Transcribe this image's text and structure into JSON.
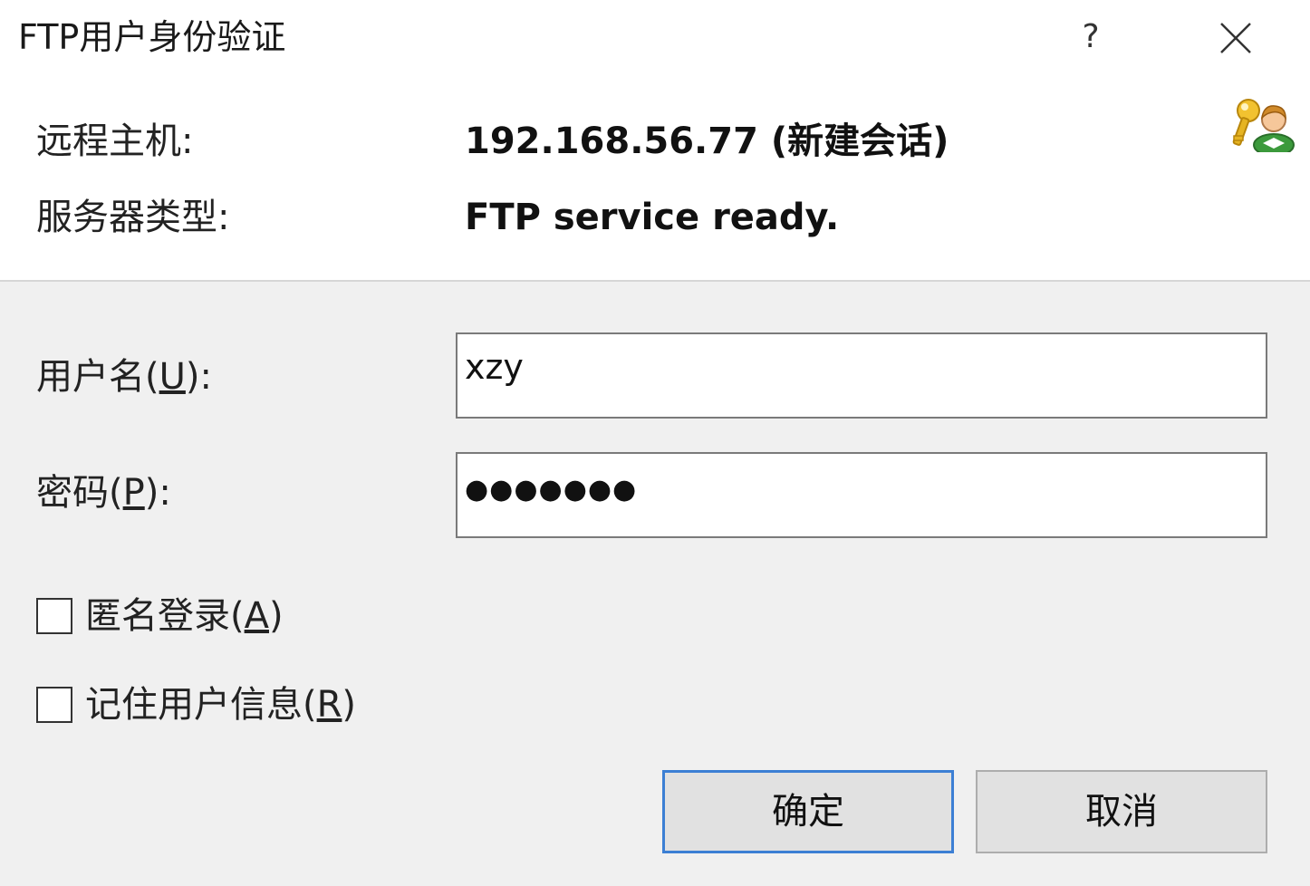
{
  "dialog": {
    "title": "FTP用户身份验证",
    "help_label": "?",
    "close_icon": "close-icon"
  },
  "info": {
    "host_label": "远程主机:",
    "host_value": "192.168.56.77 (新建会话)",
    "server_type_label": "服务器类型:",
    "server_type_value": "FTP service ready.",
    "icon": "user-key-icon"
  },
  "form": {
    "username_label_pre": "用户名(",
    "username_label_key": "U",
    "username_label_post": "):",
    "username_value": "xzy",
    "password_label_pre": "密码(",
    "password_label_key": "P",
    "password_label_post": "):",
    "password_mask": "●●●●●●●",
    "anonymous_pre": "匿名登录(",
    "anonymous_key": "A",
    "anonymous_post": ")",
    "anonymous_checked": false,
    "remember_pre": "记住用户信息(",
    "remember_key": "R",
    "remember_post": ")",
    "remember_checked": false
  },
  "buttons": {
    "ok_label": "确定",
    "cancel_label": "取消"
  },
  "colors": {
    "accent_border": "#3c7fd4",
    "dialog_background": "#f0f0f0"
  }
}
